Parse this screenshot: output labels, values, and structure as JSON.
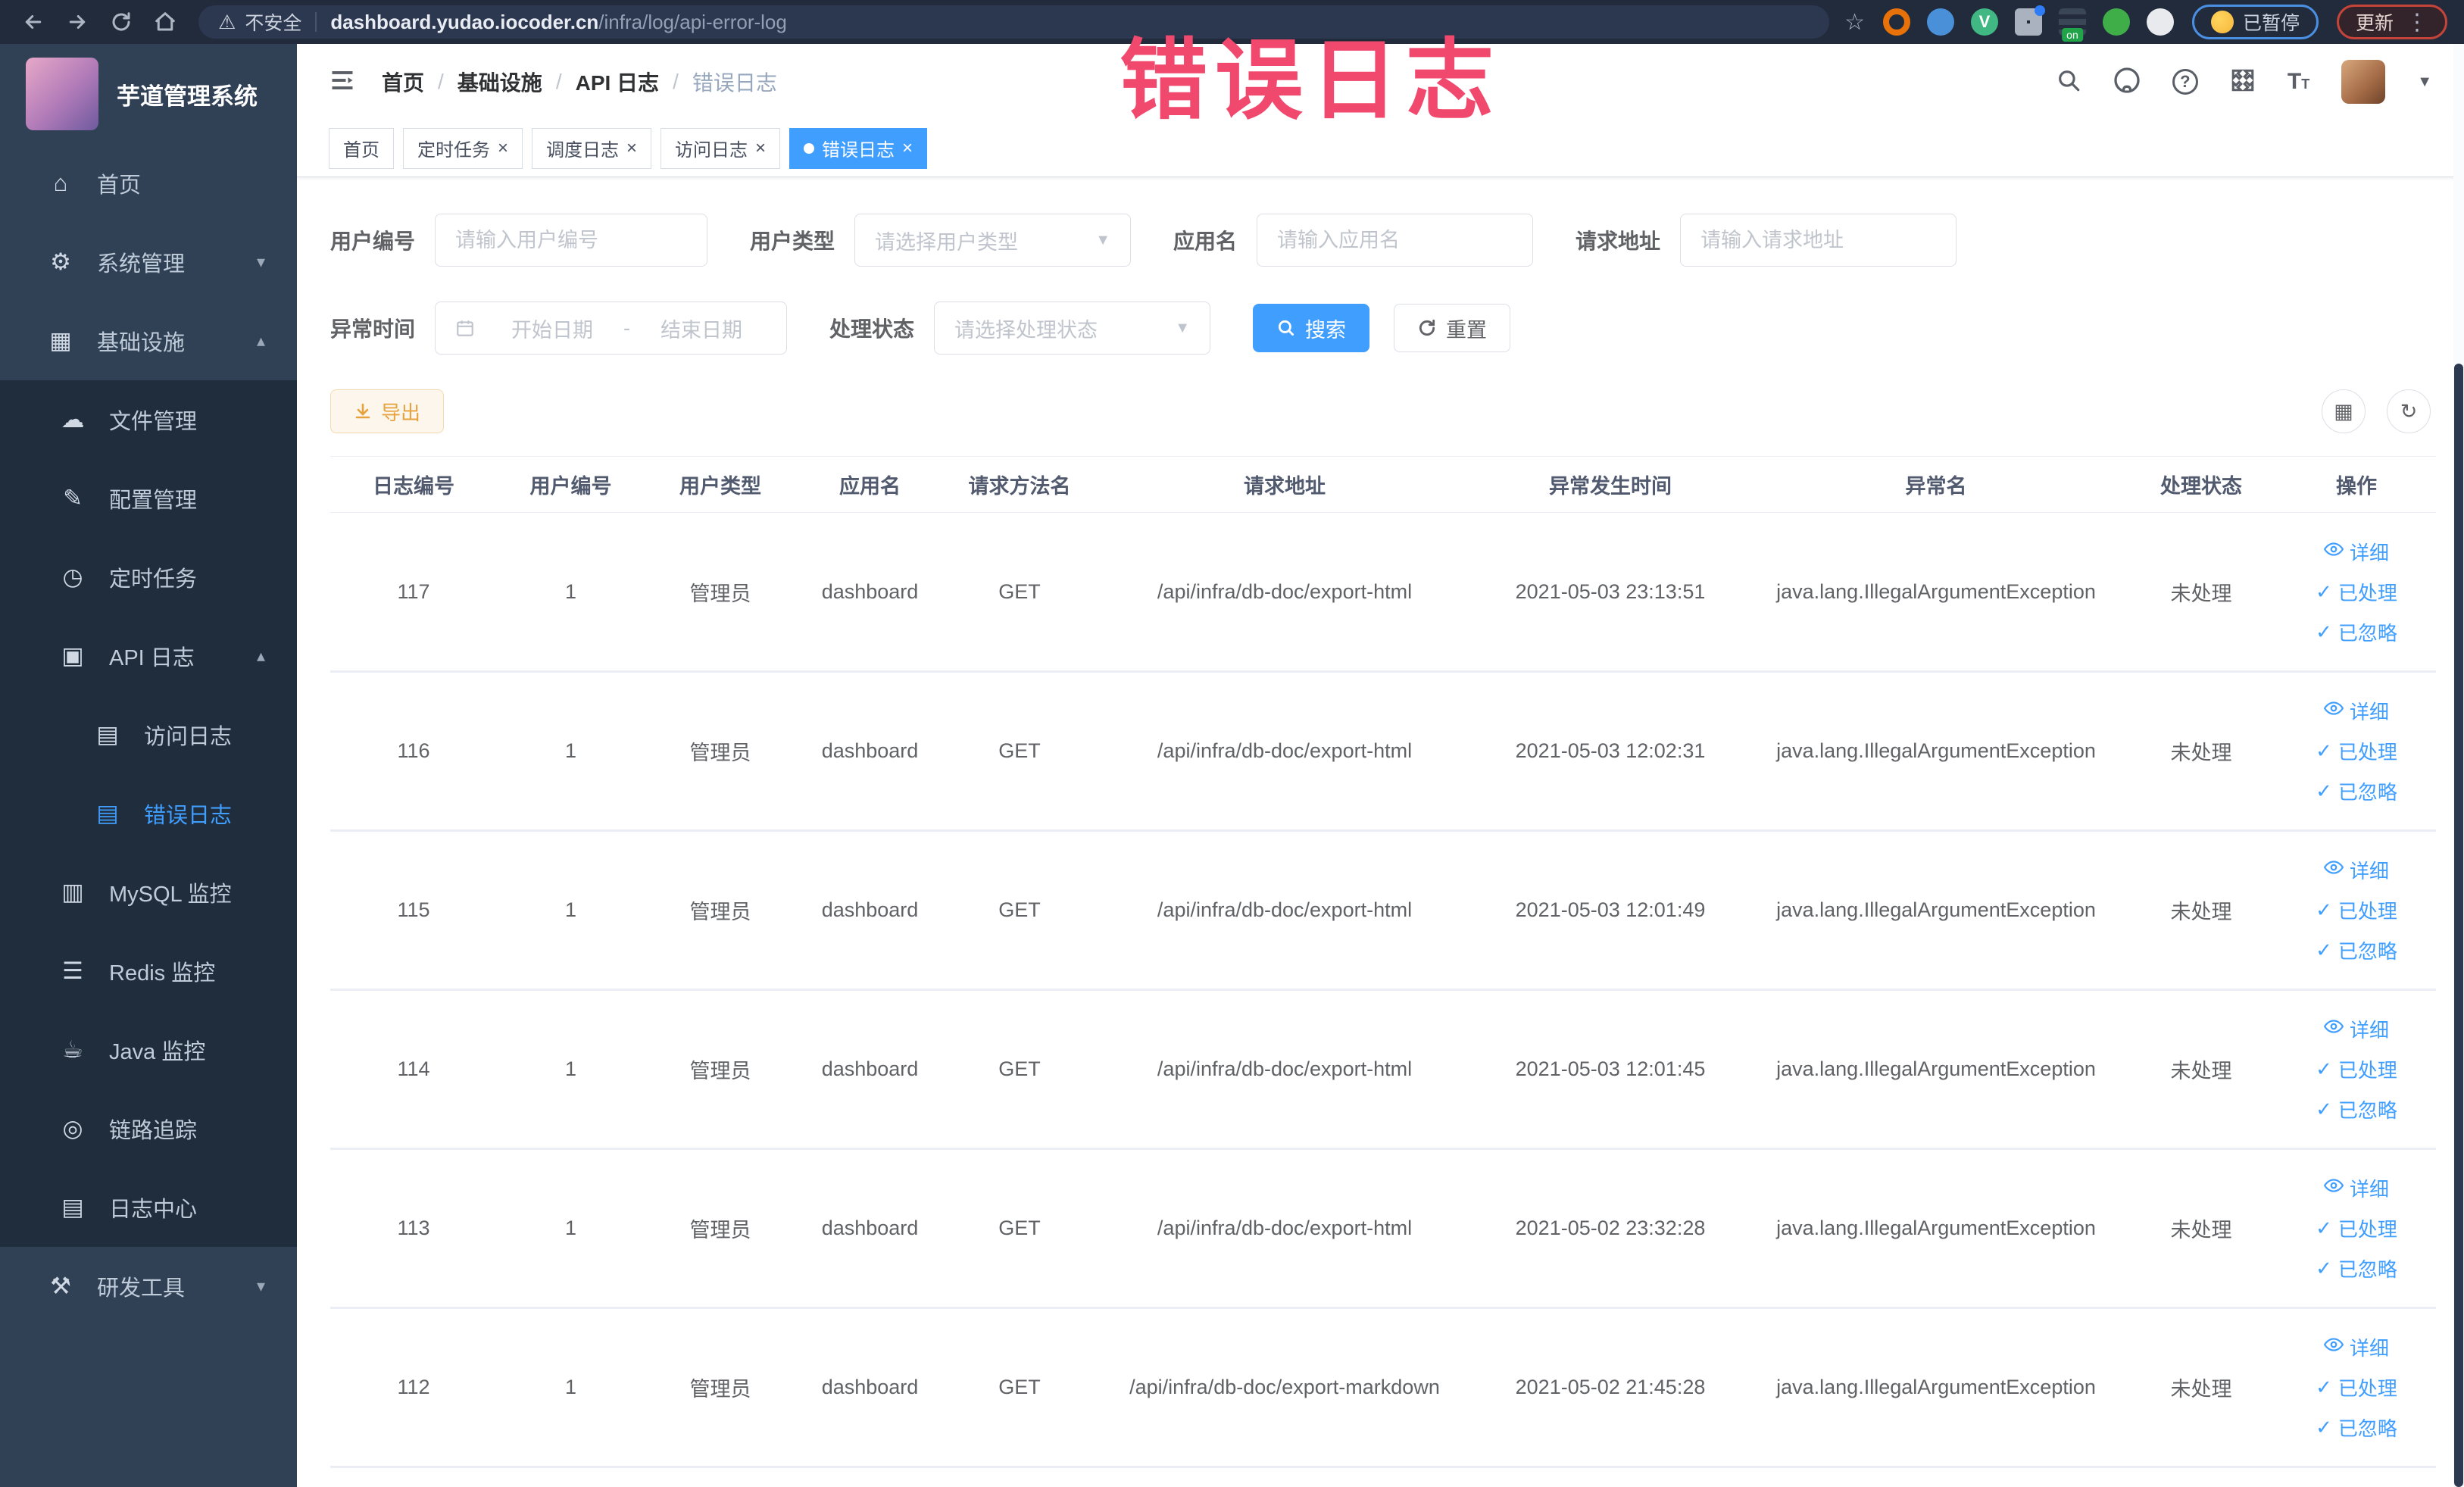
{
  "browser": {
    "security_label": "不安全",
    "url_host": "dashboard.yudao.iocoder.cn",
    "url_path": "/infra/log/api-error-log",
    "paused_label": "已暂停",
    "update_label": "更新",
    "extensions": [
      {
        "key": "ext-orange-ring",
        "style": "ring",
        "color": "#e8710a"
      },
      {
        "key": "ext-blue-shield",
        "style": "circle",
        "color": "#4a90d9",
        "glyph": ""
      },
      {
        "key": "ext-vue-devtools",
        "style": "circle",
        "color": "#41b883",
        "glyph": "V"
      },
      {
        "key": "ext-grid",
        "style": "grid",
        "color": "#aab2c0",
        "dot": "#2f7cf6"
      },
      {
        "key": "ext-switch",
        "style": "rows",
        "color": "#3a4556",
        "badge": "on"
      },
      {
        "key": "ext-green-plant",
        "style": "circle",
        "color": "#3fae49",
        "glyph": ""
      },
      {
        "key": "ext-puzzle",
        "style": "circle",
        "color": "#e8eaed",
        "glyph": ""
      }
    ]
  },
  "annotation": {
    "text": "错误日志",
    "color": "#f1486e"
  },
  "sidebar": {
    "logo_title": "芋道管理系统",
    "items": [
      {
        "key": "home",
        "label": "首页",
        "icon": "home-icon",
        "depth": 0
      },
      {
        "key": "system-management",
        "label": "系统管理",
        "icon": "gear-icon",
        "depth": 0,
        "chevron": "down"
      },
      {
        "key": "infrastructure",
        "label": "基础设施",
        "icon": "infrastructure-icon",
        "depth": 0,
        "chevron": "up"
      },
      {
        "key": "file-management",
        "label": "文件管理",
        "icon": "cloud-file-icon",
        "depth": 1
      },
      {
        "key": "config-management",
        "label": "配置管理",
        "icon": "edit-config-icon",
        "depth": 1
      },
      {
        "key": "scheduled-tasks",
        "label": "定时任务",
        "icon": "timer-icon",
        "depth": 1
      },
      {
        "key": "api-log",
        "label": "API 日志",
        "icon": "api-log-icon",
        "depth": 1,
        "chevron": "up"
      },
      {
        "key": "access-log",
        "label": "访问日志",
        "icon": "access-log-icon",
        "depth": 2
      },
      {
        "key": "error-log",
        "label": "错误日志",
        "icon": "error-log-icon",
        "depth": 2,
        "active": true
      },
      {
        "key": "mysql-monitor",
        "label": "MySQL 监控",
        "icon": "mysql-monitor-icon",
        "depth": 1
      },
      {
        "key": "redis-monitor",
        "label": "Redis 监控",
        "icon": "redis-monitor-icon",
        "depth": 1
      },
      {
        "key": "java-monitor",
        "label": "Java 监控",
        "icon": "java-monitor-icon",
        "depth": 1
      },
      {
        "key": "trace",
        "label": "链路追踪",
        "icon": "trace-icon",
        "depth": 1
      },
      {
        "key": "log-center",
        "label": "日志中心",
        "icon": "log-center-icon",
        "depth": 1
      },
      {
        "key": "dev-tools",
        "label": "研发工具",
        "icon": "devtools-icon",
        "depth": 0,
        "chevron": "down"
      }
    ]
  },
  "header": {
    "breadcrumb": [
      "首页",
      "基础设施",
      "API 日志",
      "错误日志"
    ]
  },
  "tabs": [
    {
      "key": "home",
      "label": "首页",
      "closable": false,
      "active": false
    },
    {
      "key": "scheduled-tasks",
      "label": "定时任务",
      "closable": true,
      "active": false
    },
    {
      "key": "schedule-log",
      "label": "调度日志",
      "closable": true,
      "active": false
    },
    {
      "key": "access-log",
      "label": "访问日志",
      "closable": true,
      "active": false
    },
    {
      "key": "error-log",
      "label": "错误日志",
      "closable": true,
      "active": true
    }
  ],
  "filters": {
    "user_id_label": "用户编号",
    "user_id_placeholder": "请输入用户编号",
    "user_type_label": "用户类型",
    "user_type_placeholder": "请选择用户类型",
    "app_name_label": "应用名",
    "app_name_placeholder": "请输入应用名",
    "request_url_label": "请求地址",
    "request_url_placeholder": "请输入请求地址",
    "exception_time_label": "异常时间",
    "date_start_placeholder": "开始日期",
    "date_separator": "-",
    "date_end_placeholder": "结束日期",
    "process_status_label": "处理状态",
    "process_status_placeholder": "请选择处理状态",
    "search_label": "搜索",
    "reset_label": "重置"
  },
  "toolbar": {
    "export_label": "导出"
  },
  "table": {
    "columns": [
      "日志编号",
      "用户编号",
      "用户类型",
      "应用名",
      "请求方法名",
      "请求地址",
      "异常发生时间",
      "异常名",
      "处理状态",
      "操作"
    ],
    "action_labels": {
      "detail": "详细",
      "processed": "已处理",
      "ignored": "已忽略"
    },
    "rows": [
      {
        "id": "117",
        "user_id": "1",
        "user_type": "管理员",
        "app_name": "dashboard",
        "method": "GET",
        "url": "/api/infra/db-doc/export-html",
        "time": "2021-05-03 23:13:51",
        "exception": "java.lang.IllegalArgumentException",
        "status": "未处理"
      },
      {
        "id": "116",
        "user_id": "1",
        "user_type": "管理员",
        "app_name": "dashboard",
        "method": "GET",
        "url": "/api/infra/db-doc/export-html",
        "time": "2021-05-03 12:02:31",
        "exception": "java.lang.IllegalArgumentException",
        "status": "未处理"
      },
      {
        "id": "115",
        "user_id": "1",
        "user_type": "管理员",
        "app_name": "dashboard",
        "method": "GET",
        "url": "/api/infra/db-doc/export-html",
        "time": "2021-05-03 12:01:49",
        "exception": "java.lang.IllegalArgumentException",
        "status": "未处理"
      },
      {
        "id": "114",
        "user_id": "1",
        "user_type": "管理员",
        "app_name": "dashboard",
        "method": "GET",
        "url": "/api/infra/db-doc/export-html",
        "time": "2021-05-03 12:01:45",
        "exception": "java.lang.IllegalArgumentException",
        "status": "未处理"
      },
      {
        "id": "113",
        "user_id": "1",
        "user_type": "管理员",
        "app_name": "dashboard",
        "method": "GET",
        "url": "/api/infra/db-doc/export-html",
        "time": "2021-05-02 23:32:28",
        "exception": "java.lang.IllegalArgumentException",
        "status": "未处理"
      },
      {
        "id": "112",
        "user_id": "1",
        "user_type": "管理员",
        "app_name": "dashboard",
        "method": "GET",
        "url": "/api/infra/db-doc/export-markdown",
        "time": "2021-05-02 21:45:28",
        "exception": "java.lang.IllegalArgumentException",
        "status": "未处理"
      }
    ]
  },
  "colors": {
    "accent": "#409eff",
    "sidebar_bg": "#304156",
    "submenu_bg": "#1f2d3d",
    "warning": "#e6a23c",
    "annotation_pink": "#f1486e",
    "chrome_bg": "#212b3c"
  }
}
